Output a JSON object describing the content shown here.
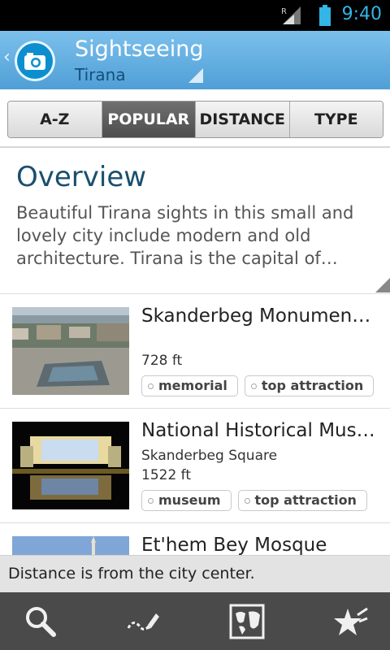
{
  "status": {
    "time": "9:40",
    "roaming": "R"
  },
  "actionbar": {
    "title": "Sightseeing",
    "subtitle": "Tirana"
  },
  "tabs": [
    {
      "label": "A-Z",
      "active": false
    },
    {
      "label": "POPULAR",
      "active": true
    },
    {
      "label": "DISTANCE",
      "active": false
    },
    {
      "label": "TYPE",
      "active": false
    }
  ],
  "overview": {
    "title": "Overview",
    "text": "Beautiful Tirana sights in this small and lovely city include modern and old architecture.  Tirana is the capital of…"
  },
  "items": [
    {
      "name": "Skanderbeg Monument (…",
      "address": "",
      "distance": "728 ft",
      "tags": [
        "memorial",
        "top attraction"
      ]
    },
    {
      "name": "National Historical Muse…",
      "address": "Skanderbeg Square",
      "distance": "1522 ft",
      "tags": [
        "museum",
        "top attraction"
      ]
    },
    {
      "name": "Et'hem Bey Mosque",
      "address": "",
      "distance": "",
      "tags": []
    }
  ],
  "notice": "Distance is from the city center.",
  "bottom_nav": [
    "search-icon",
    "draw-route-icon",
    "map-icon",
    "favorites-icon"
  ],
  "colors": {
    "accent": "#33b5e5",
    "actionbar": "#5aa9dd",
    "title": "#1a4f6e"
  }
}
